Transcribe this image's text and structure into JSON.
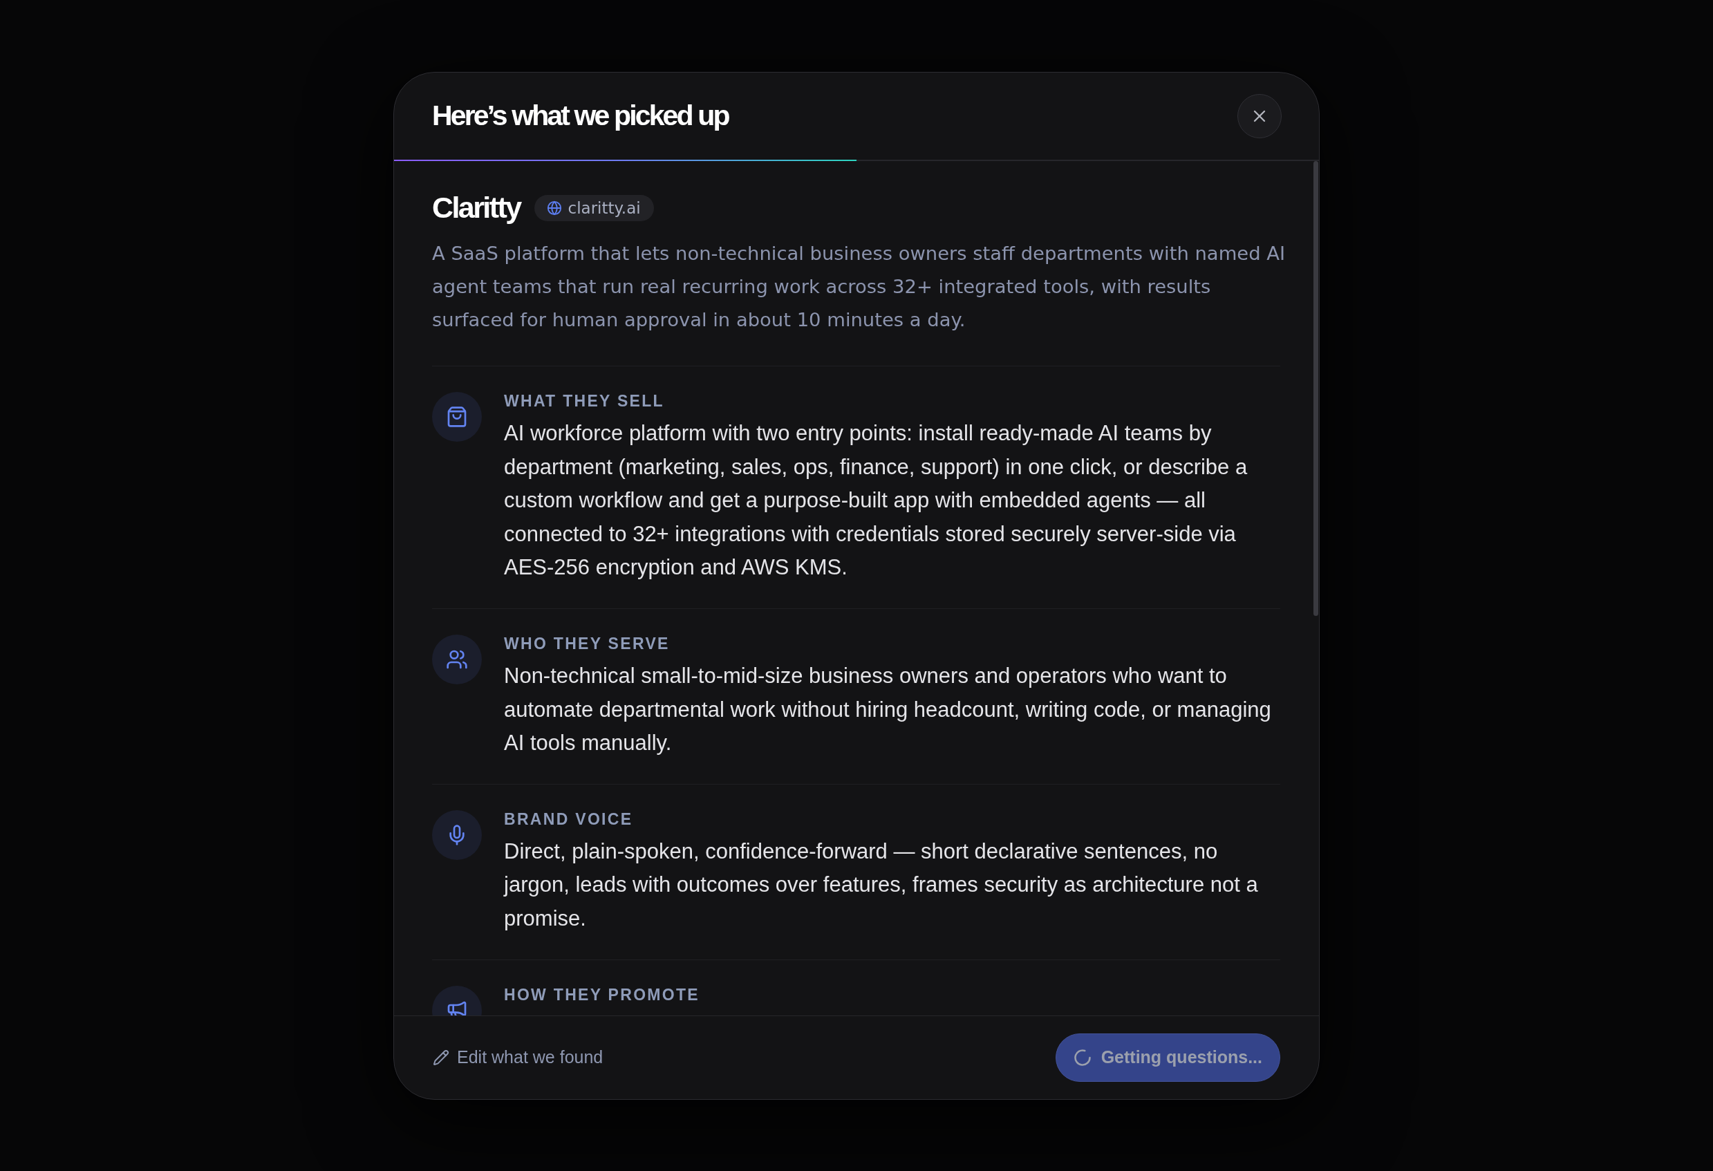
{
  "dialog": {
    "title": "Here’s what we picked up",
    "progress": {
      "level": 0.5
    }
  },
  "company": {
    "name": "Claritty",
    "domain": "claritty.ai",
    "description": "A SaaS platform that lets non-technical business owners staff departments with named AI agent teams that run real recurring work across 32+ integrated tools, with results surfaced for human approval in about 10 minutes a day."
  },
  "sections": [
    {
      "kind": "offer",
      "label": "WHAT THEY SELL",
      "text": "AI workforce platform with two entry points: install ready-made AI teams by department (marketing, sales, ops, finance, support) in one click, or describe a custom workflow and get a purpose-built app with embedded agents — all connected to 32+ integrations with credentials stored securely server-side via AES-256 encryption and AWS KMS."
    },
    {
      "kind": "audience",
      "label": "WHO THEY SERVE",
      "text": "Non-technical small-to-mid-size business owners and operators who want to automate departmental work without hiring headcount, writing code, or managing AI tools manually."
    },
    {
      "kind": "voice",
      "label": "BRAND VOICE",
      "text": "Direct, plain-spoken, confidence-forward — short declarative sentences, no jargon, leads with outcomes over features, frames security as architecture not a promise."
    },
    {
      "kind": "promotion",
      "label": "HOW THEY PROMOTE"
    }
  ],
  "footer": {
    "edit_link": "Edit what we found",
    "primary_button": {
      "label": "Getting questions...",
      "loading": true,
      "disabled": true
    }
  }
}
